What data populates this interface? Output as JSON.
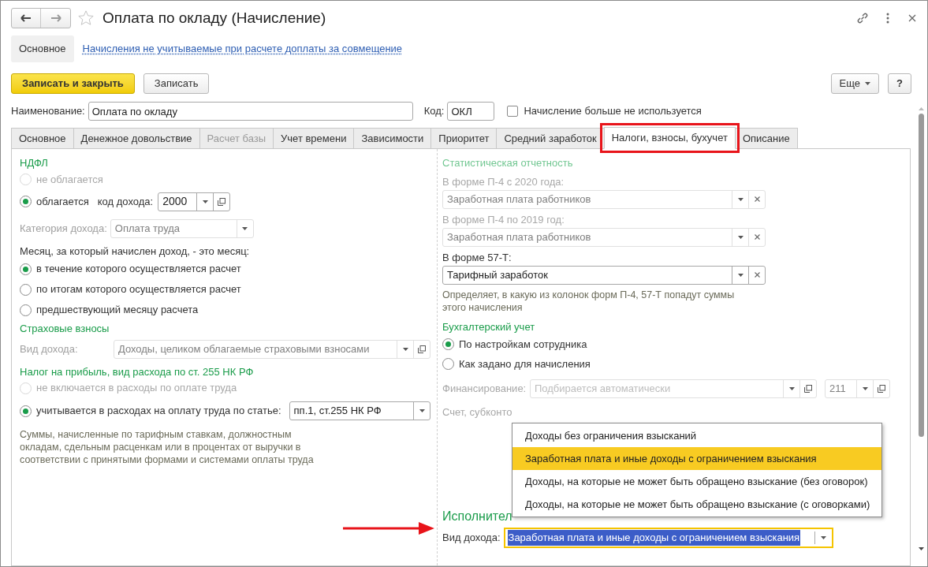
{
  "window": {
    "title": "Оплата по окладу (Начисление)",
    "favorite": false
  },
  "nav_links": [
    {
      "label": "Основное",
      "selected": true
    },
    {
      "label": "Начисления не учитываемые при расчете доплаты за совмещение",
      "selected": false
    }
  ],
  "toolbar": {
    "buttons": [
      {
        "label": "Записать и закрыть",
        "kind": "primary"
      },
      {
        "label": "Записать",
        "kind": "normal"
      }
    ],
    "more": "Еще",
    "help": "?"
  },
  "header": {
    "name_label": "Наименование:",
    "name_value": "Оплата по окладу",
    "code_label": "Код:",
    "code_value": "ОКЛ",
    "inactive_label": "Начисление больше не используется",
    "inactive_checked": false
  },
  "tabs": [
    {
      "label": "Основное",
      "selected": false,
      "disabled": false,
      "highlighted": false
    },
    {
      "label": "Денежное довольствие",
      "selected": false,
      "disabled": false,
      "highlighted": false
    },
    {
      "label": "Расчет базы",
      "selected": false,
      "disabled": true,
      "highlighted": false
    },
    {
      "label": "Учет времени",
      "selected": false,
      "disabled": false,
      "highlighted": false
    },
    {
      "label": "Зависимости",
      "selected": false,
      "disabled": false,
      "highlighted": false
    },
    {
      "label": "Приоритет",
      "selected": false,
      "disabled": false,
      "highlighted": false
    },
    {
      "label": "Средний заработок",
      "selected": false,
      "disabled": false,
      "highlighted": false
    },
    {
      "label": "Налоги, взносы, бухучет",
      "selected": true,
      "disabled": false,
      "highlighted": true
    },
    {
      "label": "Описание",
      "selected": false,
      "disabled": false,
      "highlighted": false
    }
  ],
  "ndfl": {
    "title": "НДФЛ",
    "options": [
      {
        "label": "не облагается",
        "selected": false,
        "disabled": true
      },
      {
        "label": "облагается",
        "selected": true,
        "disabled": false
      }
    ],
    "income_code_label": "код дохода:",
    "income_code_value": "2000",
    "category_label": "Категория дохода:",
    "category_value": "Оплата труда",
    "category_disabled": true,
    "month_label": "Месяц, за который начислен доход, - это месяц:",
    "month_options": [
      {
        "label": "в течение которого осуществляется расчет",
        "selected": true
      },
      {
        "label": "по итогам которого осуществляется расчет",
        "selected": false
      },
      {
        "label": "предшествующий месяцу расчета",
        "selected": false
      }
    ]
  },
  "insurance": {
    "title": "Страховые взносы",
    "income_label": "Вид дохода:",
    "income_value": "Доходы, целиком облагаемые страховыми взносами",
    "disabled": true
  },
  "profit_tax": {
    "title": "Налог на прибыль, вид расхода по ст. 255 НК РФ",
    "options": [
      {
        "label": "не включается в расходы по оплате труда",
        "selected": false,
        "disabled": true
      },
      {
        "label": "учитывается в расходах на оплату труда по статье:",
        "selected": true,
        "disabled": false
      }
    ],
    "article_value": "пп.1, ст.255 НК РФ",
    "note": "Суммы, начисленные по тарифным ставкам, должностным окладам, сдельным расценкам или в процентах от выручки в соответствии с принятыми формами и системами оплаты труда"
  },
  "statistics": {
    "title": "Статистическая отчетность",
    "title_disabled": true,
    "fields": [
      {
        "label": "В форме П-4 с 2020 года:",
        "value": "Заработная плата работников",
        "disabled": true
      },
      {
        "label": "В форме П-4 по 2019 год:",
        "value": "Заработная плата работников",
        "disabled": true
      },
      {
        "label": "В форме 57-Т:",
        "value": "Тарифный заработок",
        "disabled": false
      }
    ],
    "note": "Определяет, в какую из колонок форм П-4, 57-Т попадут суммы этого начисления"
  },
  "accounting": {
    "title": "Бухгалтерский учет",
    "options": [
      {
        "label": "По настройкам сотрудника",
        "selected": true
      },
      {
        "label": "Как задано для начисления",
        "selected": false
      }
    ],
    "financing_label": "Финансирование:",
    "financing_placeholder": "Подбирается автоматически",
    "financing_code": "211",
    "account_label": "Счет, субконто"
  },
  "executive": {
    "title": "Исполнител",
    "income_label": "Вид дохода:",
    "income_value": "Заработная плата и иные доходы с ограничением взыскания"
  },
  "dropdown": {
    "items": [
      {
        "label": "Доходы без ограничения взысканий",
        "selected": false
      },
      {
        "label": "Заработная плата и иные доходы с ограничением взыскания",
        "selected": true
      },
      {
        "label": "Доходы, на которые не может быть обращено взыскание (без оговорок)",
        "selected": false
      },
      {
        "label": "Доходы, на которые не может быть обращено взыскание (с оговорками)",
        "selected": false
      }
    ]
  }
}
